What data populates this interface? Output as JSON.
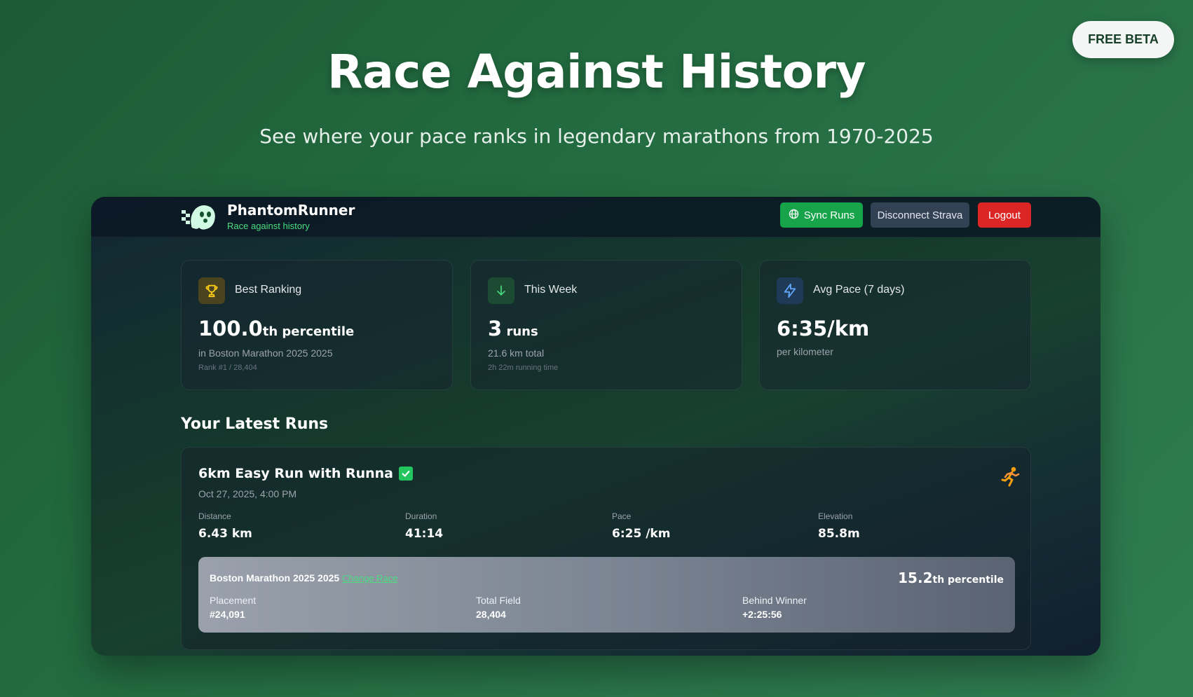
{
  "badge": {
    "label": "FREE BETA"
  },
  "hero": {
    "title": "Race Against History",
    "subtitle": "See where your pace ranks in legendary marathons from 1970-2025"
  },
  "header": {
    "brand": "PhantomRunner",
    "tagline": "Race against history",
    "logo_icon": "ghost-runner-icon",
    "buttons": {
      "sync": "Sync Runs",
      "disconnect": "Disconnect Strava",
      "logout": "Logout"
    }
  },
  "stats": [
    {
      "label": "Best Ranking",
      "icon": "trophy-icon",
      "value": "100.0",
      "unit": "th percentile",
      "sub": "in Boston Marathon 2025 2025",
      "sub2": "Rank #1 / 28,404"
    },
    {
      "label": "This Week",
      "icon": "arrow-down-icon",
      "value": "3",
      "unit": " runs",
      "sub": "21.6 km total",
      "sub2": "2h 22m running time"
    },
    {
      "label": "Avg Pace (7 days)",
      "icon": "lightning-icon",
      "value": "6:35/km",
      "unit": "",
      "sub": "per kilometer",
      "sub2": ""
    }
  ],
  "latest_runs": {
    "title": "Your Latest Runs",
    "runs": [
      {
        "name": "6km Easy Run with Runna",
        "verified_icon": "check-box-icon",
        "type_icon": "runner-icon",
        "date": "Oct 27, 2025, 4:00 PM",
        "metrics": [
          {
            "label": "Distance",
            "value": "6.43 km"
          },
          {
            "label": "Duration",
            "value": "41:14"
          },
          {
            "label": "Pace",
            "value": "6:25 /km"
          },
          {
            "label": "Elevation",
            "value": "85.8m"
          }
        ],
        "race": {
          "name": "Boston Marathon 2025 2025",
          "change_label": "Change Race",
          "percentile": "15.2",
          "percentile_unit": "th percentile",
          "placement_label": "Placement",
          "placement": "#24,091",
          "field_label": "Total Field",
          "field": "28,404",
          "behind_label": "Behind Winner",
          "behind": "+2:25:56"
        }
      }
    ]
  },
  "colors": {
    "accent_green": "#16a34a",
    "link_green": "#4ade80",
    "danger_red": "#dc2626",
    "slate": "#334155",
    "trophy_gold": "#facc15",
    "pace_blue": "#60a5fa"
  }
}
